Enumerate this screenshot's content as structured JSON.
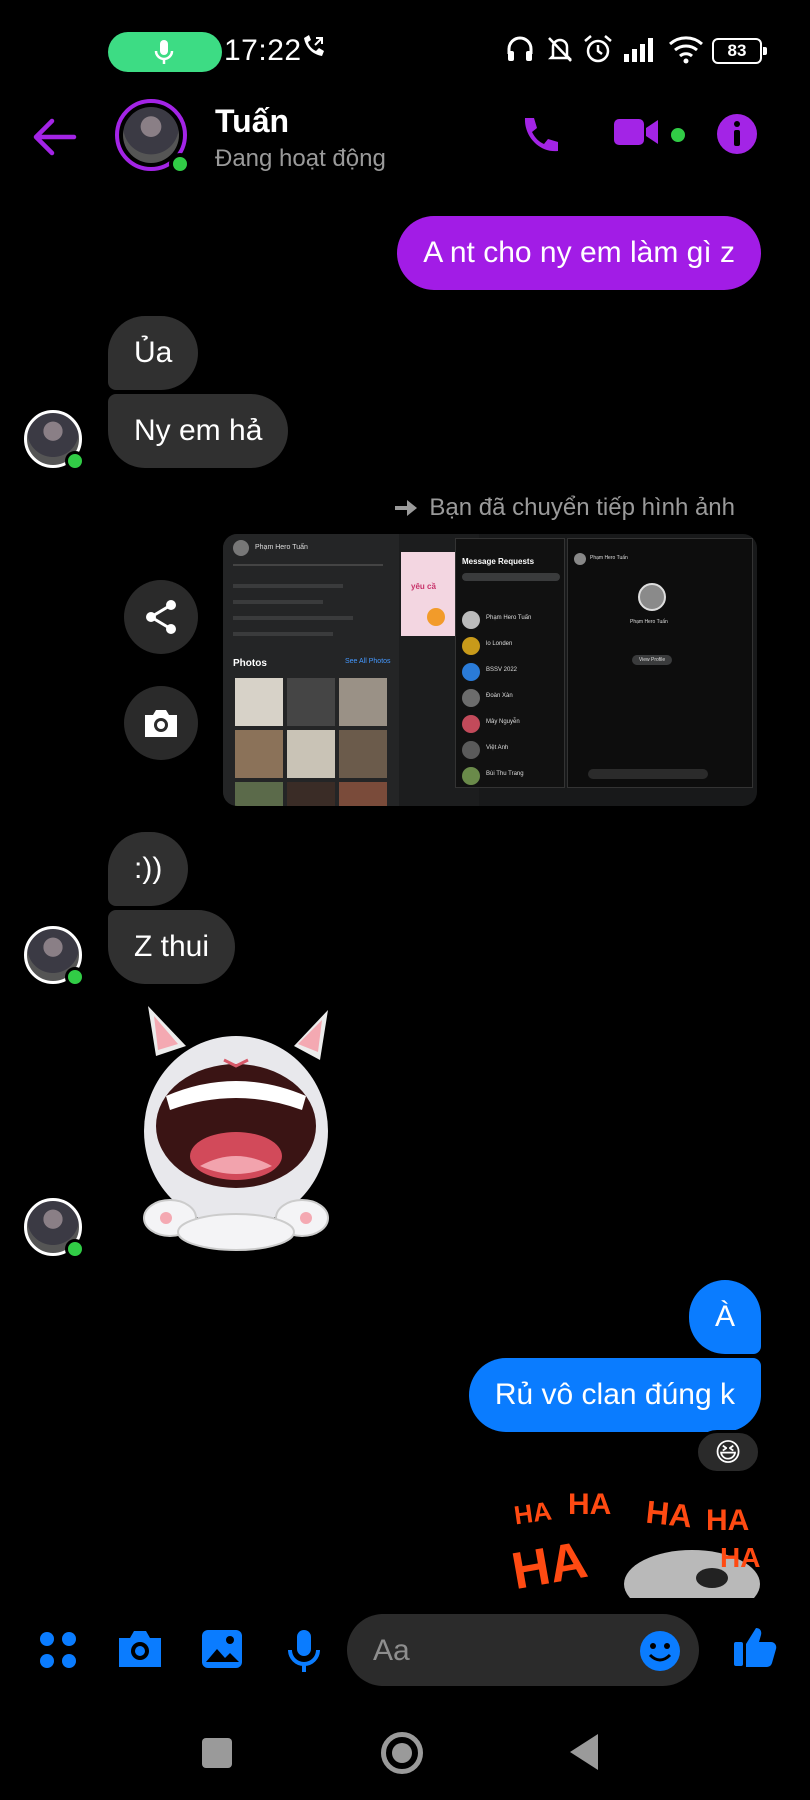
{
  "status_bar": {
    "time": "17:22",
    "battery": "83",
    "icons": [
      "mic-icon",
      "wifi-call-icon",
      "headphones-icon",
      "mute-bell-icon",
      "alarm-icon",
      "signal-icon",
      "wifi-icon",
      "battery-icon"
    ]
  },
  "header": {
    "contact_name": "Tuấn",
    "contact_status": "Đang hoạt động",
    "accent_color": "#a324e6",
    "icons": [
      "back-arrow-icon",
      "phone-icon",
      "video-camera-icon",
      "info-icon"
    ]
  },
  "messages": [
    {
      "side": "out",
      "text": "A nt cho ny em làm gì z",
      "color": "#a21ce6"
    },
    {
      "side": "in",
      "text": "Ủa"
    },
    {
      "side": "in",
      "text": "Ny em hả"
    },
    {
      "side": "system",
      "text": "Bạn đã chuyển tiếp hình ảnh"
    },
    {
      "side": "in",
      "text": ":))"
    },
    {
      "side": "in",
      "text": "Z thui"
    },
    {
      "side": "in",
      "type": "sticker",
      "sticker": "laughing-bunny"
    },
    {
      "side": "out",
      "text": "À",
      "color": "#0a7cff"
    },
    {
      "side": "out",
      "text": "Rủ vô clan đúng k",
      "color": "#0a7cff",
      "reaction": "😆"
    },
    {
      "side": "out",
      "type": "sticker",
      "sticker": "haha-cat"
    }
  ],
  "forwarded_image": {
    "profile_name": "Phạm Hero Tuấn",
    "photos_title": "Photos",
    "see_all": "See All Photos",
    "requests_title": "Message Requests",
    "request_items": [
      "Phạm Hero Tuấn",
      "lo Londen",
      "BSSV 2022",
      "Đoàn Xàn",
      "Mây Nguyễn",
      "Việt Anh",
      "Bùi Thu Trang"
    ],
    "view_profile": "View Profile",
    "pink_text": "yêu cầ"
  },
  "composer": {
    "placeholder": "Aa",
    "icons": [
      "menu-dots-icon",
      "camera-icon",
      "gallery-icon",
      "mic-icon",
      "emoji-icon",
      "like-icon"
    ],
    "accent_color": "#0a7cff"
  },
  "stickers": {
    "haha_text": [
      "HA",
      "HA",
      "HA",
      "HA",
      "HA",
      "HA"
    ]
  }
}
